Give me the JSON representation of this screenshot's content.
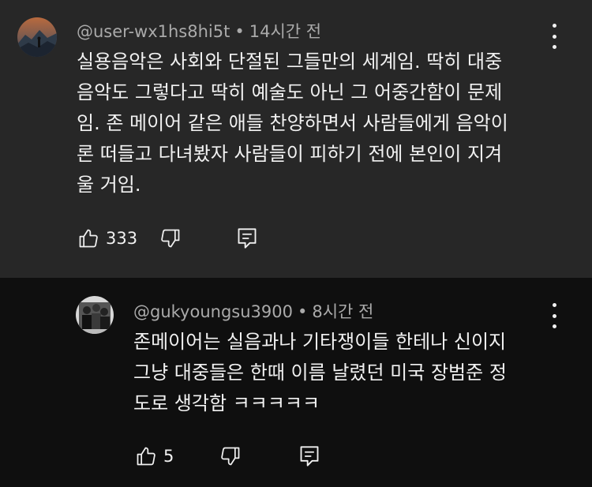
{
  "top_comment": {
    "username": "@user-wx1hs8hi5t",
    "time": "14시간 전",
    "lines": [
      "실용음악은 사회와 단절된 그들만의 세계임. 딱히 대중",
      "음악도 그렇다고 딱히 예술도 아닌 그 어중간함이 문제",
      "임. 존 메이어 같은 애들 찬양하면서 사람들에게 음악이",
      "론 떠들고 다녀봤자 사람들이 피하기 전에 본인이 지겨",
      "울 거임."
    ],
    "like_count": "333"
  },
  "reply_comment": {
    "username": "@gukyoungsu3900",
    "time": "8시간 전",
    "lines": [
      "존메이어는 실음과나 기타쟁이들 한테나 신이지",
      "그냥 대중들은 한때 이름 날렸던 미국 장범준 정",
      "도로 생각함 ㅋㅋㅋㅋㅋ"
    ],
    "like_count": "5"
  },
  "separator": "•",
  "icons": [
    "thumbs-up-icon",
    "thumbs-down-icon",
    "reply-icon",
    "more-vert-icon"
  ],
  "colors": {
    "top_bg": "#272727",
    "reply_bg": "#0f0f0f",
    "text": "#f1f1f1",
    "meta": "#aaaaaa"
  }
}
